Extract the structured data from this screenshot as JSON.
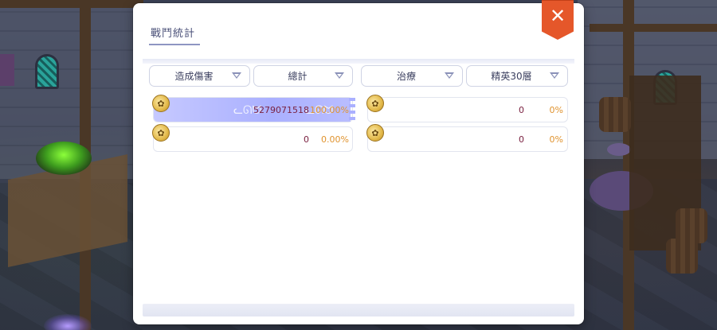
{
  "panel": {
    "title": "戰鬥統計",
    "close_icon": "close-x-icon",
    "close_glyph": "✕"
  },
  "filters": {
    "left": [
      {
        "label": "造成傷害"
      },
      {
        "label": "總計"
      }
    ],
    "right": [
      {
        "label": "治療"
      },
      {
        "label": "精英30層"
      }
    ]
  },
  "damage_rows": [
    {
      "value": "5279071518",
      "percent": "100.00%",
      "share": 1.0
    },
    {
      "value": "0",
      "percent": "0.00%",
      "share": 0.0
    }
  ],
  "heal_rows": [
    {
      "value": "0",
      "percent": "0%",
      "share": 0.0
    },
    {
      "value": "0",
      "percent": "0%",
      "share": 0.0
    }
  ],
  "colors": {
    "close_button": "#e5572a",
    "bar_fill": "#aab0ff",
    "value_text": "#7a2140",
    "percent_text": "#e0932e"
  }
}
